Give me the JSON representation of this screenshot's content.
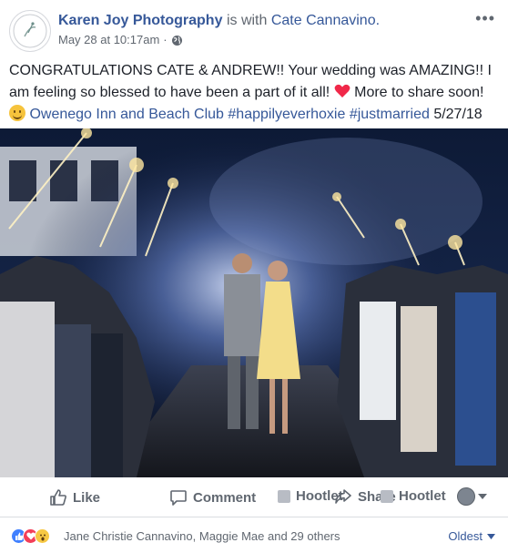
{
  "post": {
    "author": "Karen Joy Photography",
    "with_text": "is with",
    "tagged": "Cate Cannavino.",
    "date": "May 28 at 10:17am",
    "date_separator": "·",
    "privacy_icon": "globe-icon",
    "more_icon": "more-icon",
    "more_label": "•••",
    "text_part1": "CONGRATULATIONS CATE & ANDREW!! Your wedding was AMAZING!! I am feeling so blessed to have been a part of it all!",
    "text_part2": "More to share soon!",
    "location": "Owenego Inn and Beach Club",
    "hashtags": [
      "#happilyeverhoxie",
      "#justmarried"
    ],
    "posted_date": "5/27/18"
  },
  "actions": {
    "like": "Like",
    "comment": "Comment",
    "hootlet": "Hootlet",
    "share": "Share",
    "share_hootlet": "Hootlet"
  },
  "reactions": {
    "names": "Jane Christie Cannavino, Maggie Mae and 29 others",
    "sort_label": "Oldest",
    "icons": [
      "like-reaction-icon",
      "love-reaction-icon",
      "wow-reaction-icon"
    ]
  },
  "colors": {
    "link": "#365899",
    "meta": "#606770",
    "text": "#1d2129",
    "like_blue": "#4080ff",
    "love_red": "#f33e58",
    "wow_yellow": "#f7c844"
  }
}
